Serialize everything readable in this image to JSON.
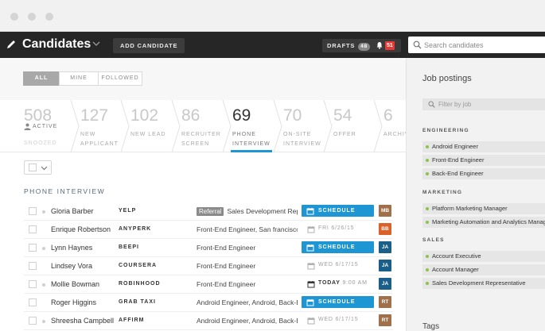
{
  "header": {
    "app_title": "Candidates",
    "add_candidate": "ADD CANDIDATE",
    "drafts_label": "DRAFTS",
    "drafts_count": "48",
    "notifications_count": "51",
    "search_placeholder": "Search candidates"
  },
  "filters": {
    "tabs": [
      {
        "label": "ALL",
        "active": true
      },
      {
        "label": "MINE",
        "active": false
      },
      {
        "label": "FOLLOWED",
        "active": false
      }
    ]
  },
  "stages": {
    "active": {
      "count": "508",
      "label": "ACTIVE",
      "snoozed": "SNOOZED"
    },
    "items": [
      {
        "count": "127",
        "label1": "NEW",
        "label2": "APPLICANT"
      },
      {
        "count": "102",
        "label1": "NEW LEAD",
        "label2": ""
      },
      {
        "count": "86",
        "label1": "RECRUITER",
        "label2": "SCREEN"
      },
      {
        "count": "69",
        "label1": "PHONE",
        "label2": "INTERVIEW",
        "current": true
      },
      {
        "count": "70",
        "label1": "ON-SITE",
        "label2": "INTERVIEW"
      },
      {
        "count": "54",
        "label1": "OFFER",
        "label2": ""
      },
      {
        "count": "6",
        "label1": "ARCHIVED",
        "label2": ""
      }
    ]
  },
  "section_title": "PHONE INTERVIEW",
  "candidates": [
    {
      "name": "Gloria Barber",
      "company": "YELP",
      "pill": "Referral",
      "role": "Sales Development Repr",
      "schedule": "button",
      "schedule_label": "SCHEDULE",
      "initials": "MB",
      "avatar_color": "#a0704a"
    },
    {
      "name": "Enrique Robertson",
      "company": "ANYPERK",
      "pill": "",
      "role": "Front-End Engineer, San francisco,",
      "schedule": "date",
      "schedule_label": "FRI 6/26/15",
      "initials": "BB",
      "avatar_color": "#d9622b"
    },
    {
      "name": "Lynn Haynes",
      "company": "BEEPI",
      "pill": "",
      "role": "Front-End Engineer",
      "schedule": "button",
      "schedule_label": "SCHEDULE",
      "initials": "JA",
      "avatar_color": "#1a5e8a"
    },
    {
      "name": "Lindsey Vora",
      "company": "COURSERA",
      "pill": "",
      "role": "Front-End Engineer",
      "schedule": "date",
      "schedule_label": "WED 6/17/15",
      "initials": "JA",
      "avatar_color": "#1a5e8a"
    },
    {
      "name": "Mollie Bowman",
      "company": "ROBINHOOD",
      "pill": "",
      "role": "Front-End Engineer",
      "schedule": "today",
      "schedule_label": "TODAY",
      "schedule_time": "9:00 AM",
      "initials": "JA",
      "avatar_color": "#1a5e8a"
    },
    {
      "name": "Roger Higgins",
      "company": "GRAB TAXI",
      "pill": "",
      "role": "Android Engineer, Android, Back-E",
      "schedule": "button",
      "schedule_label": "SCHEDULE",
      "initials": "RT",
      "avatar_color": "#a0704a"
    },
    {
      "name": "Shreesha Campbell",
      "company": "AFFIRM",
      "pill": "",
      "role": "Android Engineer, Android, Back-E",
      "schedule": "date",
      "schedule_label": "WED 6/17/15",
      "initials": "RT",
      "avatar_color": "#a0704a"
    }
  ],
  "job_postings": {
    "title": "Job postings",
    "filter_placeholder": "Filter by job",
    "groups": [
      {
        "name": "ENGINEERING",
        "jobs": [
          "Android Engineer",
          "Front-End Engineer",
          "Back-End Engineer"
        ]
      },
      {
        "name": "MARKETING",
        "jobs": [
          "Platform Marketing Manager",
          "Marketing Automation and Analytics Manager"
        ]
      },
      {
        "name": "SALES",
        "jobs": [
          "Account Executive",
          "Account Manager",
          "Sales Development Representative"
        ]
      }
    ],
    "tags_title": "Tags"
  },
  "colors": {
    "accent": "#1e96d4",
    "topbar": "#262626",
    "badge_red": "#e53935",
    "job_dot": "#8bc34a"
  }
}
